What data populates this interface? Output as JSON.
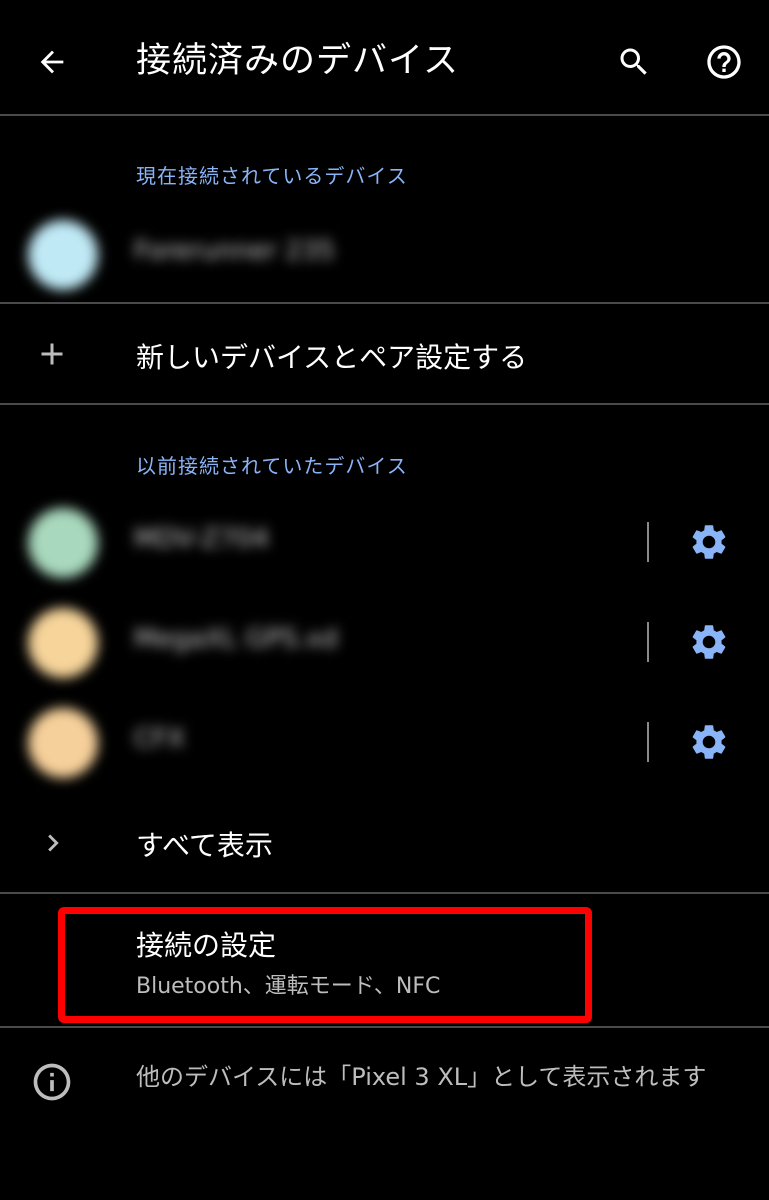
{
  "header": {
    "title": "接続済みのデバイス",
    "back_icon": "arrow-left-icon",
    "search_icon": "search-icon",
    "help_icon": "help-circle-icon"
  },
  "current_section": {
    "header": "現在接続されているデバイス",
    "device": {
      "name": "Forerunner 235",
      "avatar_color": "#bfe9f5"
    }
  },
  "pair_new": {
    "label": "新しいデバイスとペア設定する",
    "icon": "plus-icon"
  },
  "previous_section": {
    "header": "以前接続されていたデバイス",
    "devices": [
      {
        "name": "MDV-Z704",
        "avatar_color": "#a8d8bd"
      },
      {
        "name": "MegaXL GPS.xd",
        "avatar_color": "#f6d49a"
      },
      {
        "name": "CFX",
        "avatar_color": "#f6d09a"
      }
    ],
    "gear_color": "#8ab4f8"
  },
  "show_all": {
    "label": "すべて表示",
    "icon": "chevron-right-icon"
  },
  "connection_settings": {
    "title": "接続の設定",
    "subtitle": "Bluetooth、運転モード、NFC",
    "highlight_color": "#ff0000"
  },
  "footer": {
    "text": "他のデバイスには「Pixel 3 XL」として表示されます",
    "icon": "info-icon"
  }
}
